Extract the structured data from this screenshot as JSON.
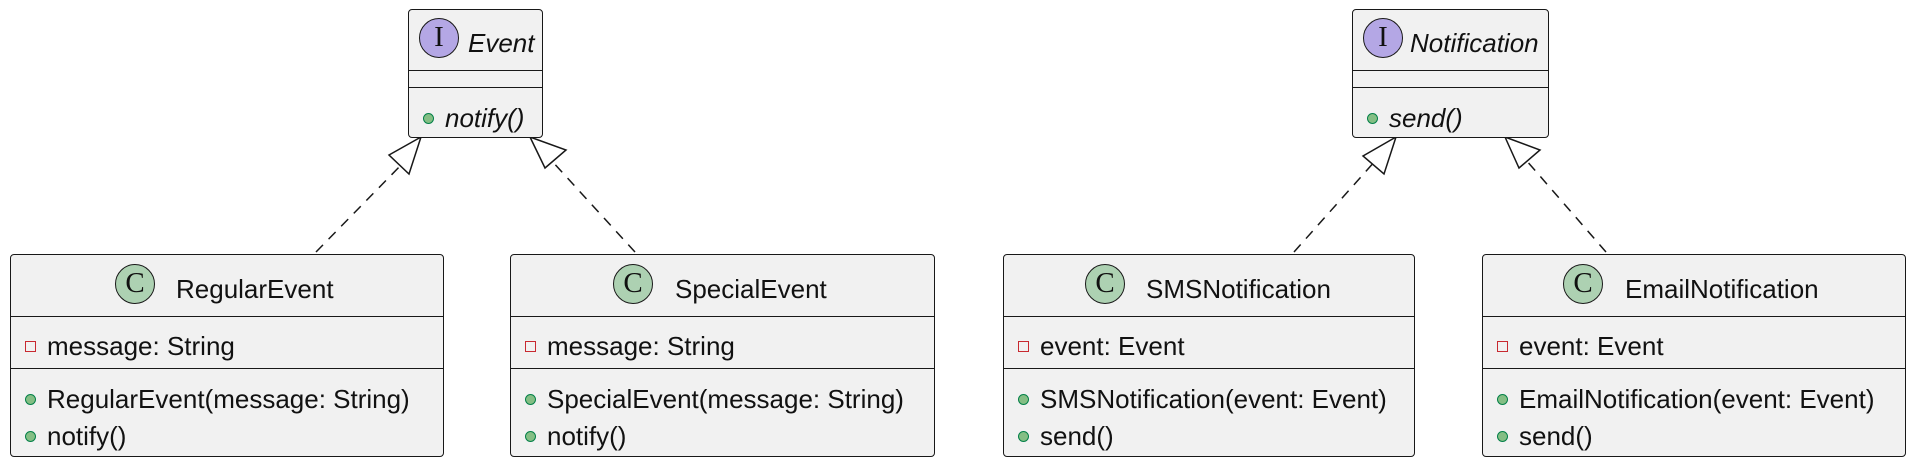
{
  "diagram": {
    "interfaces": [
      {
        "name": "Event",
        "stereotype_glyph": "I",
        "methods": [
          "notify()"
        ]
      },
      {
        "name": "Notification",
        "stereotype_glyph": "I",
        "methods": [
          "send()"
        ]
      }
    ],
    "classes": [
      {
        "name": "RegularEvent",
        "stereotype_glyph": "C",
        "fields": [
          "message: String"
        ],
        "methods": [
          "RegularEvent(message: String)",
          "notify()"
        ],
        "implements": "Event"
      },
      {
        "name": "SpecialEvent",
        "stereotype_glyph": "C",
        "fields": [
          "message: String"
        ],
        "methods": [
          "SpecialEvent(message: String)",
          "notify()"
        ],
        "implements": "Event"
      },
      {
        "name": "SMSNotification",
        "stereotype_glyph": "C",
        "fields": [
          "event: Event"
        ],
        "methods": [
          "SMSNotification(event: Event)",
          "send()"
        ],
        "implements": "Notification"
      },
      {
        "name": "EmailNotification",
        "stereotype_glyph": "C",
        "fields": [
          "event: Event"
        ],
        "methods": [
          "EmailNotification(event: Event)",
          "send()"
        ],
        "implements": "Notification"
      }
    ],
    "colors": {
      "box_fill": "#f1f1f1",
      "border": "#181818",
      "interface_badge": "#b4a7e5",
      "class_badge": "#add1b2",
      "public_marker": "#84be84",
      "private_marker": "#c82930"
    }
  }
}
